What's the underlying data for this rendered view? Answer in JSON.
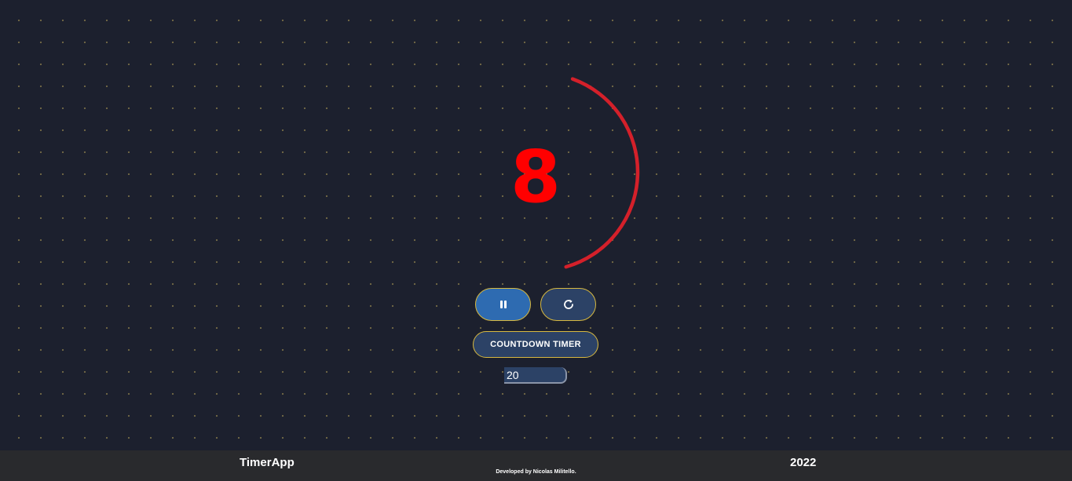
{
  "timer": {
    "display_value": "8",
    "display_color": "#ff0000",
    "progress_color": "#d4202a",
    "remaining_fraction": 0.4
  },
  "controls": {
    "pause_icon": "pause-icon",
    "reset_icon": "refresh-icon",
    "mode_label": "COUNTDOWN TIMER",
    "duration_value": "20"
  },
  "footer": {
    "brand": "TimerApp",
    "credit": "Developed by Nicolas Militello.",
    "year": "2022"
  },
  "colors": {
    "background": "#1c202e",
    "primary_button": "#2e6bb1",
    "secondary_button": "#2c4266",
    "button_border": "#d8b940",
    "footer_bg": "#292a2d"
  }
}
